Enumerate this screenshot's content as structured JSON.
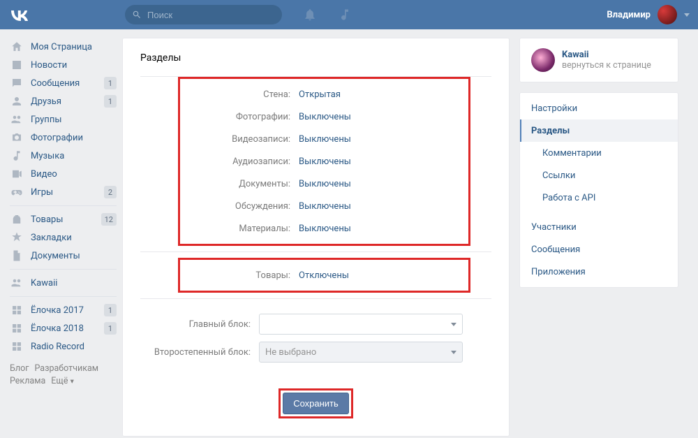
{
  "header": {
    "search_placeholder": "Поиск",
    "username": "Владимир"
  },
  "nav": {
    "items": [
      {
        "icon": "home",
        "label": "Моя Страница"
      },
      {
        "icon": "news",
        "label": "Новости"
      },
      {
        "icon": "messages",
        "label": "Сообщения",
        "badge": "1"
      },
      {
        "icon": "friends",
        "label": "Друзья",
        "badge": "1"
      },
      {
        "icon": "groups",
        "label": "Группы"
      },
      {
        "icon": "photos",
        "label": "Фотографии"
      },
      {
        "icon": "music",
        "label": "Музыка"
      },
      {
        "icon": "video",
        "label": "Видео"
      },
      {
        "icon": "games",
        "label": "Игры",
        "badge": "2"
      }
    ],
    "items2": [
      {
        "icon": "market",
        "label": "Товары",
        "badge": "12"
      },
      {
        "icon": "bookmark",
        "label": "Закладки"
      },
      {
        "icon": "docs",
        "label": "Документы"
      }
    ],
    "items3": [
      {
        "icon": "groups",
        "label": "Kawaii"
      }
    ],
    "items4": [
      {
        "icon": "app",
        "label": "Ёлочка 2017",
        "badge": "1"
      },
      {
        "icon": "app",
        "label": "Ёлочка 2018",
        "badge": "1"
      },
      {
        "icon": "app",
        "label": "Radio Record"
      }
    ]
  },
  "footer": {
    "l0": "Блог",
    "l1": "Разработчикам",
    "l2": "Реклама",
    "l3": "Ещё"
  },
  "content": {
    "title": "Разделы",
    "rows1": [
      {
        "label": "Стена:",
        "value": "Открытая"
      },
      {
        "label": "Фотографии:",
        "value": "Выключены"
      },
      {
        "label": "Видеозаписи:",
        "value": "Выключены"
      },
      {
        "label": "Аудиозаписи:",
        "value": "Выключены"
      },
      {
        "label": "Документы:",
        "value": "Выключены"
      },
      {
        "label": "Обсуждения:",
        "value": "Выключены"
      },
      {
        "label": "Материалы:",
        "value": "Выключены"
      }
    ],
    "rows2": [
      {
        "label": "Товары:",
        "value": "Отключены"
      }
    ],
    "main_block_label": "Главный блок:",
    "secondary_block_label": "Второстепенный блок:",
    "secondary_block_value": "Не выбрано",
    "save": "Сохранить"
  },
  "right": {
    "group_name": "Kawaii",
    "group_sub": "вернуться к странице",
    "menu": [
      {
        "label": "Настройки"
      },
      {
        "label": "Разделы",
        "active": true
      },
      {
        "label": "Комментарии",
        "sub": true
      },
      {
        "label": "Ссылки",
        "sub": true
      },
      {
        "label": "Работа с API",
        "sub": true
      },
      {
        "divider": true
      },
      {
        "label": "Участники"
      },
      {
        "label": "Сообщения"
      },
      {
        "label": "Приложения"
      }
    ]
  }
}
